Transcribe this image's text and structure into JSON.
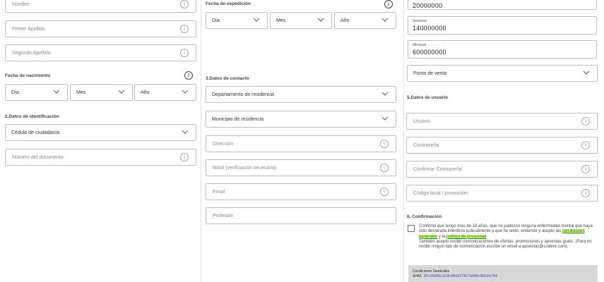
{
  "col1": {
    "nombre_placeholder": "Nombre",
    "primer_apellido_placeholder": "Primer Apellido",
    "segundo_apellido_placeholder": "Segundo Apellido",
    "fecha_nacimiento_label": "Fecha de nacimiento",
    "dia": "Día",
    "mes": "Mes",
    "ano": "Año",
    "section2_title": "2.Datos de identificación",
    "tipo_documento": "Cédula de ciudadanía",
    "numero_documento_placeholder": "Número del documento"
  },
  "col2": {
    "fecha_expedicion_label": "Fecha de expedición",
    "dia": "Día",
    "mes": "Mes",
    "ano": "Año",
    "section3_title": "3.Datos de contacto",
    "departamento": "Departamento de residencia",
    "municipio": "Municipio de residencia",
    "direccion_placeholder": "Dirección",
    "movil_placeholder": "Móvil (verificación necesaria)",
    "email_placeholder": "Email",
    "profesion_placeholder": "Profesión"
  },
  "col3": {
    "diario_value": "20000000",
    "semanal_label": "Semanal",
    "semanal_value": "140000000",
    "mensual_label": "Mensual",
    "mensual_value": "600000000",
    "punto_venta": "Punto de venta",
    "section5_title": "5.Datos de usuario",
    "usuario_placeholder": "Usuario",
    "contrasena_placeholder": "Contraseña",
    "confirmar_placeholder": "Confirmar Contraseña",
    "codigo_placeholder": "Código local / promoción",
    "section6_title": "6. Confirmación",
    "consent_part1": "Confirmo que tengo más de 18 años, que no padezco ninguna enfermedad mental que haya sido declarada interdicta judicialmente y que he leído, entiendo y acepto las",
    "consent_link1": "condiciones generales",
    "consent_part2": " y la ",
    "consent_link2": "política de privacidad",
    "consent_part3": "También acepto recibir comunicaciones de ofertas, promociones y apuestas gratis. (Para no recibir ningún tipo de comunicación escribe un email a apuestas@codere.com).",
    "terms_title": "Condiciones Generales",
    "terms_hash_label": "SHA1: ",
    "terms_hash_value": "9f7c39d45c1136c84e9279573d9fbc3fb51fc784"
  },
  "icons": {
    "info": "info-icon",
    "chevron": "chevron-down-icon"
  }
}
